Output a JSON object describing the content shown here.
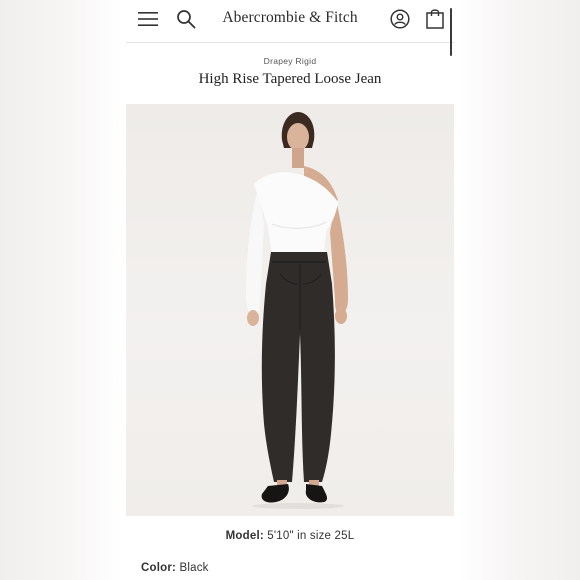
{
  "header": {
    "brand": "Abercrombie & Fitch",
    "menu_icon": "hamburger-menu-icon",
    "search_icon": "search-icon",
    "account_icon": "account-icon",
    "bag_icon": "shopping-bag-icon"
  },
  "product": {
    "collection": "Drapey Rigid",
    "title": "High Rise Tapered Loose Jean",
    "image_alt": "Model wearing white off-shoulder top and black loose tapered jeans",
    "model_label": "Model:",
    "model_value": "5'10\" in size 25L",
    "color_label": "Color:",
    "color_value": "Black"
  },
  "colors": {
    "text": "#333333",
    "divider": "#e6e6e6",
    "image_bg": "#f1eeeb"
  }
}
